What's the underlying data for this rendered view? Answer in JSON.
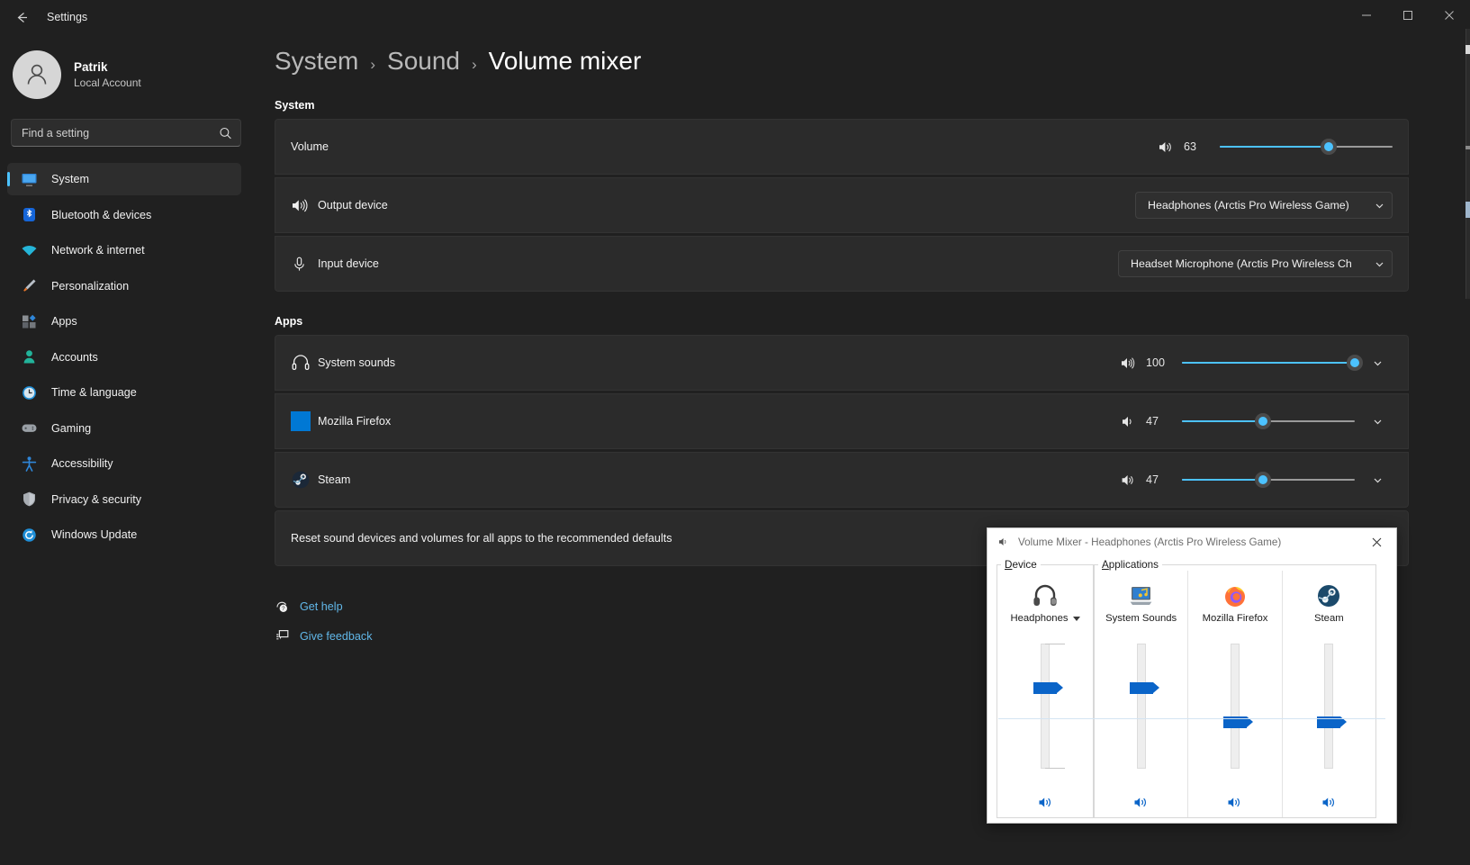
{
  "window": {
    "title": "Settings",
    "back_icon": "back-arrow-icon",
    "minimize_label": "Minimize",
    "maximize_label": "Maximize",
    "close_label": "Close"
  },
  "sidebar": {
    "profile": {
      "name": "Patrik",
      "subtitle": "Local Account",
      "avatar_icon": "user-avatar-icon"
    },
    "search": {
      "placeholder": "Find a setting",
      "value": "",
      "icon": "search-icon"
    },
    "items": [
      {
        "label": "System",
        "icon": "monitor-icon",
        "active": true
      },
      {
        "label": "Bluetooth & devices",
        "icon": "bluetooth-icon",
        "active": false
      },
      {
        "label": "Network & internet",
        "icon": "wifi-icon",
        "active": false
      },
      {
        "label": "Personalization",
        "icon": "paintbrush-icon",
        "active": false
      },
      {
        "label": "Apps",
        "icon": "apps-grid-icon",
        "active": false
      },
      {
        "label": "Accounts",
        "icon": "person-icon",
        "active": false
      },
      {
        "label": "Time & language",
        "icon": "clock-icon",
        "active": false
      },
      {
        "label": "Gaming",
        "icon": "gamepad-icon",
        "active": false
      },
      {
        "label": "Accessibility",
        "icon": "accessibility-icon",
        "active": false
      },
      {
        "label": "Privacy & security",
        "icon": "shield-icon",
        "active": false
      },
      {
        "label": "Windows Update",
        "icon": "update-icon",
        "active": false
      }
    ]
  },
  "breadcrumb": {
    "root": "System",
    "parent": "Sound",
    "current": "Volume mixer",
    "separator": "›"
  },
  "system_section": {
    "heading": "System",
    "volume": {
      "label": "Volume",
      "value": 63,
      "value_text": "63",
      "min": 0,
      "max": 100,
      "speaker_icon": "speaker-medium-icon"
    },
    "output_device": {
      "label": "Output device",
      "icon": "speaker-loud-icon",
      "value": "Headphones (Arctis Pro Wireless Game)",
      "chevron_icon": "chevron-down-icon"
    },
    "input_device": {
      "label": "Input device",
      "icon": "microphone-icon",
      "value": "Headset Microphone (Arctis Pro Wireless Ch",
      "chevron_icon": "chevron-down-icon"
    }
  },
  "apps_section": {
    "heading": "Apps",
    "rows": [
      {
        "name": "System sounds",
        "icon": "headphones-icon",
        "value": 100,
        "value_text": "100",
        "speaker_icon": "speaker-loud-icon",
        "chevron_icon": "chevron-down-icon"
      },
      {
        "name": "Mozilla Firefox",
        "icon": "firefox-square-icon",
        "value": 47,
        "value_text": "47",
        "speaker_icon": "speaker-low-icon",
        "chevron_icon": "chevron-down-icon"
      },
      {
        "name": "Steam",
        "icon": "steam-icon",
        "value": 47,
        "value_text": "47",
        "speaker_icon": "speaker-medium-icon",
        "chevron_icon": "chevron-down-icon"
      }
    ],
    "reset_text": "Reset sound devices and volumes for all apps to the recommended defaults"
  },
  "footer_links": [
    {
      "label": "Get help",
      "icon": "help-icon"
    },
    {
      "label": "Give feedback",
      "icon": "feedback-icon"
    }
  ],
  "mixer_window": {
    "title": "Volume Mixer - Headphones (Arctis Pro Wireless Game)",
    "title_icon": "speaker-small-icon",
    "close_label": "✕",
    "device_group": {
      "label": "Device",
      "accel": "D",
      "rest": "evice",
      "channel": {
        "name": "Headphones",
        "icon": "headphones-photo-icon",
        "level": 63,
        "muted": false,
        "mute_icon": "speaker-blue-icon",
        "has_dropdown": true
      }
    },
    "applications_group": {
      "label": "Applications",
      "accel": "A",
      "rest": "pplications",
      "channels": [
        {
          "name": "System Sounds",
          "icon": "system-sounds-icon",
          "level": 63,
          "muted": false,
          "mute_icon": "speaker-blue-icon"
        },
        {
          "name": "Mozilla Firefox",
          "icon": "firefox-logo-icon",
          "level": 28,
          "muted": false,
          "mute_icon": "speaker-blue-icon"
        },
        {
          "name": "Steam",
          "icon": "steam-logo-icon",
          "level": 28,
          "muted": false,
          "mute_icon": "speaker-blue-icon"
        }
      ]
    }
  },
  "colors": {
    "accent": "#4cc2ff",
    "window_bg": "#202020",
    "card_bg": "#2b2b2b",
    "link": "#61b7e8",
    "legacy_accent": "#0a64c8",
    "firefox_square": "#0078d4"
  }
}
